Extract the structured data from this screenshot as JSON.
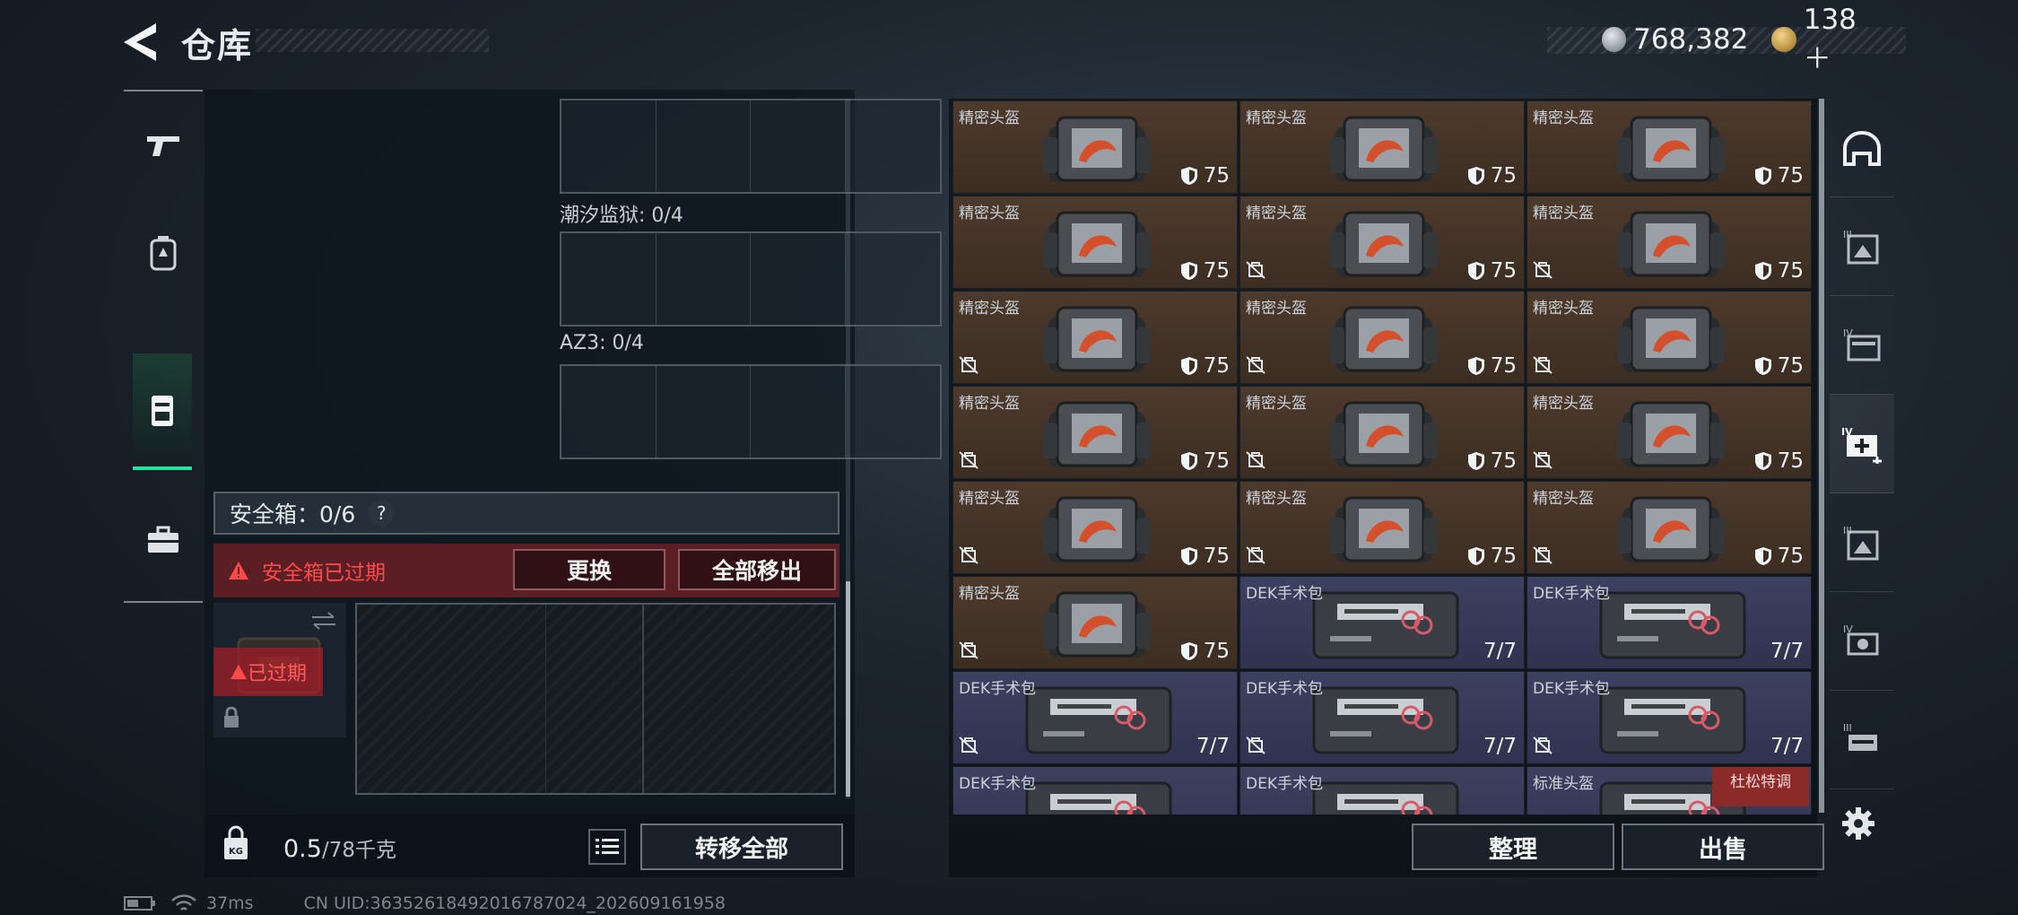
{
  "header": {
    "title": "仓库",
    "currency": {
      "silver": "768,382",
      "gold": "138＋"
    }
  },
  "left_tabs": [
    "pistol-icon",
    "backpack-icon",
    "chest-rig-icon",
    "toolbox-icon"
  ],
  "storage": {
    "sections": [
      {
        "label": "潮汐监狱: 0/4"
      },
      {
        "label": "AZ3: 0/4"
      }
    ],
    "safe_box": {
      "label": "安全箱：0/6",
      "help": "?",
      "expired_message": "安全箱已过期",
      "expired_tag": "已过期",
      "replace_label": "更换",
      "move_all_label": "全部移出"
    },
    "weight": {
      "current": "0.5",
      "capacity": "/78千克"
    },
    "transfer_all_label": "转移全部"
  },
  "inventory": {
    "items": [
      {
        "name": "精密头盔",
        "value": "75",
        "type": "helmet",
        "sellable": true
      },
      {
        "name": "精密头盔",
        "value": "75",
        "type": "helmet",
        "sellable": true
      },
      {
        "name": "精密头盔",
        "value": "75",
        "type": "helmet",
        "sellable": true
      },
      {
        "name": "精密头盔",
        "value": "75",
        "type": "helmet",
        "sellable": true
      },
      {
        "name": "精密头盔",
        "value": "75",
        "type": "helmet",
        "sellable": false
      },
      {
        "name": "精密头盔",
        "value": "75",
        "type": "helmet",
        "sellable": false
      },
      {
        "name": "精密头盔",
        "value": "75",
        "type": "helmet",
        "sellable": false
      },
      {
        "name": "精密头盔",
        "value": "75",
        "type": "helmet",
        "sellable": false
      },
      {
        "name": "精密头盔",
        "value": "75",
        "type": "helmet",
        "sellable": false
      },
      {
        "name": "精密头盔",
        "value": "75",
        "type": "helmet",
        "sellable": false
      },
      {
        "name": "精密头盔",
        "value": "75",
        "type": "helmet",
        "sellable": false
      },
      {
        "name": "精密头盔",
        "value": "75",
        "type": "helmet",
        "sellable": false
      },
      {
        "name": "精密头盔",
        "value": "75",
        "type": "helmet",
        "sellable": false
      },
      {
        "name": "精密头盔",
        "value": "75",
        "type": "helmet",
        "sellable": false
      },
      {
        "name": "精密头盔",
        "value": "75",
        "type": "helmet",
        "sellable": false
      },
      {
        "name": "精密头盔",
        "value": "75",
        "type": "helmet",
        "sellable": false
      },
      {
        "name": "DEK手术包",
        "value": "7/7",
        "type": "medkit",
        "sellable": true
      },
      {
        "name": "DEK手术包",
        "value": "7/7",
        "type": "medkit",
        "sellable": true
      },
      {
        "name": "DEK手术包",
        "value": "7/7",
        "type": "medkit",
        "sellable": false
      },
      {
        "name": "DEK手术包",
        "value": "7/7",
        "type": "medkit",
        "sellable": false
      },
      {
        "name": "DEK手术包",
        "value": "7/7",
        "type": "medkit",
        "sellable": false
      },
      {
        "name": "DEK手术包",
        "value": "",
        "type": "medkit",
        "sellable": true
      },
      {
        "name": "DEK手术包",
        "value": "",
        "type": "medkit",
        "sellable": true
      },
      {
        "name": "标准头盔",
        "value": "",
        "type": "medkit",
        "sellable": true,
        "mark": "杜松特调"
      }
    ],
    "sort_label": "整理",
    "sell_label": "出售"
  },
  "right_categories": [
    "helmet-category-icon",
    "armor-iii-icon",
    "folder-iv-icon",
    "medkit-iv-icon",
    "armor-iii-alt-icon",
    "gear-iv-icon",
    "rig-iii-icon"
  ],
  "settings_icon": "gear-icon",
  "status": {
    "ping": "37ms",
    "uid": "CN UID:3635261849201678702​4_202609161958"
  },
  "colors": {
    "accent_green": "#28e0a0",
    "expired_red": "#ff4a48",
    "helmet_bg": "#4c3a2c",
    "medkit_bg": "#3d4160"
  }
}
